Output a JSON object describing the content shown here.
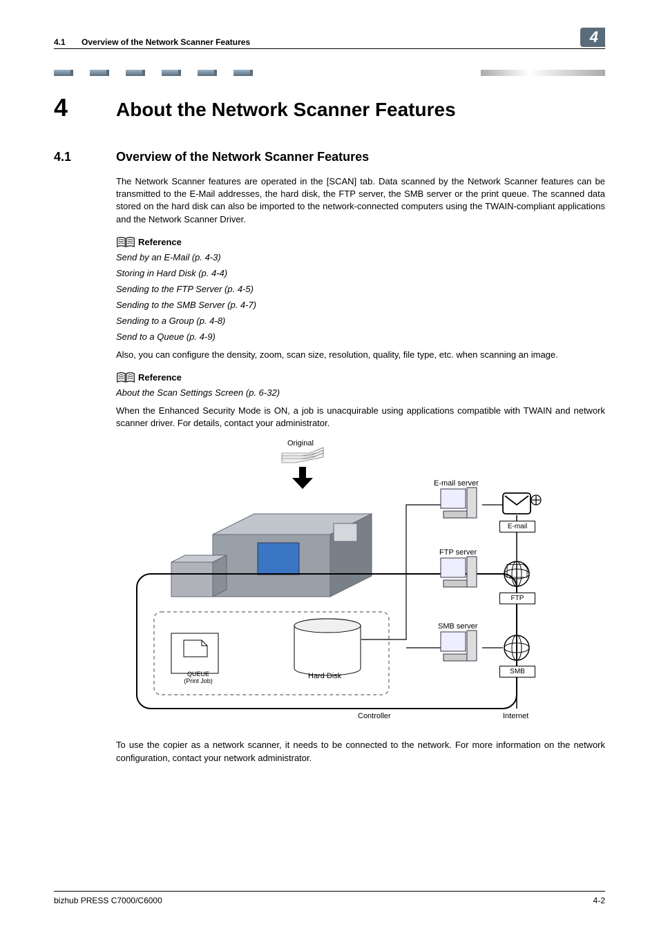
{
  "header": {
    "section_number": "4.1",
    "section_title": "Overview of the Network Scanner Features",
    "chapter_badge": "4"
  },
  "chapter": {
    "number": "4",
    "title": "About the Network Scanner Features"
  },
  "section": {
    "number": "4.1",
    "title": "Overview of the Network Scanner Features"
  },
  "paragraphs": {
    "p1": "The Network Scanner features are operated in the [SCAN] tab. Data scanned by the Network Scanner features can be transmitted to the E-Mail addresses, the hard disk, the FTP server, the SMB server or the print queue.  The scanned data stored on the hard disk can also be imported to the network-connected computers using the TWAIN-compliant applications and the Network Scanner Driver.",
    "p2": "Also, you can configure the density, zoom, scan size, resolution, quality, file type, etc. when scanning an image.",
    "p3": "When the Enhanced Security Mode is ON, a job is unacquirable using applications compatible with TWAIN and network scanner driver.  For details, contact your administrator.",
    "p4": "To use the copier as a network scanner, it needs to be connected to the network.   For more information on the network configuration, contact your network administrator."
  },
  "reference_label": "Reference",
  "references1": [
    "Send by an E-Mail (p. 4-3)",
    "Storing in Hard Disk (p. 4-4)",
    "Sending to the FTP Server (p. 4-5)",
    "Sending to the SMB Server (p. 4-7)",
    "Sending to a Group (p. 4-8)",
    "Send to a Queue (p. 4-9)"
  ],
  "references2": [
    "About the Scan Settings Screen (p. 6-32)"
  ],
  "diagram": {
    "original": "Original",
    "queue": "QUEUE",
    "printjob": "(Print Job)",
    "harddisk": "Hard Disk",
    "controller": "Controller",
    "email_server": "E-mail server",
    "ftp_server": "FTP server",
    "smb_server": "SMB server",
    "email": "E-mail",
    "ftp": "FTP",
    "smb": "SMB",
    "internet": "Internet"
  },
  "footer": {
    "product": "bizhub PRESS C7000/C6000",
    "page": "4-2"
  }
}
